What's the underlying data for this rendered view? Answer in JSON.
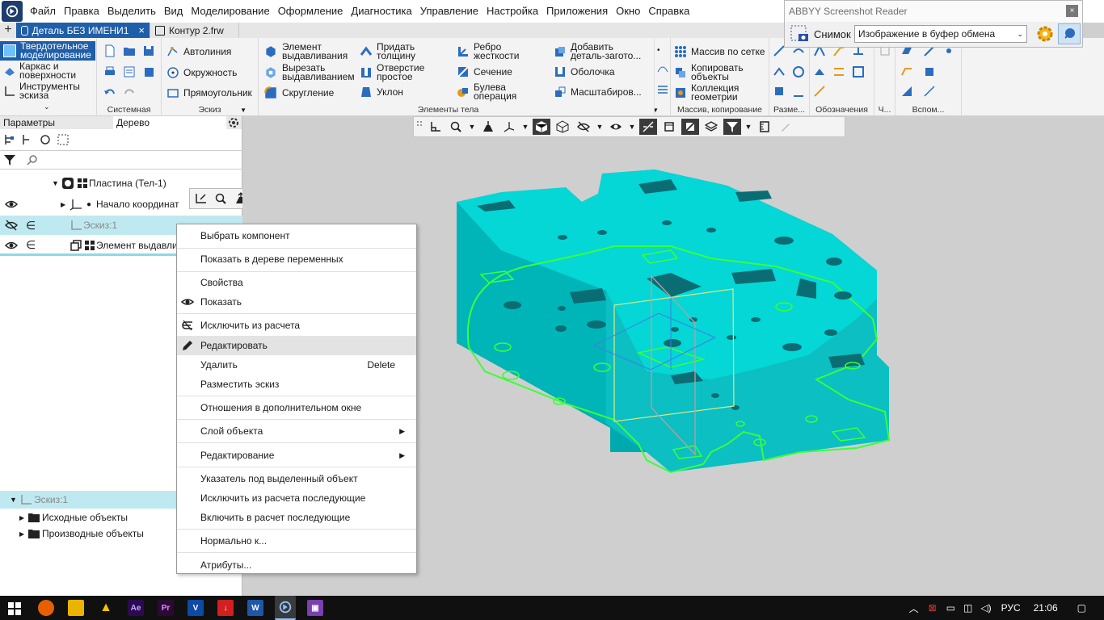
{
  "menubar": {
    "items": [
      "Файл",
      "Правка",
      "Выделить",
      "Вид",
      "Моделирование",
      "Оформление",
      "Диагностика",
      "Управление",
      "Настройка",
      "Приложения",
      "Окно",
      "Справка"
    ]
  },
  "tabs": [
    {
      "label": "Деталь БЕЗ ИМЕНИ1",
      "close": "×",
      "active": true
    },
    {
      "label": "Контур 2.frw",
      "close": "",
      "active": false
    }
  ],
  "ribbon": {
    "modes": [
      "Твердотельное моделирование",
      "Каркас и поверхности",
      "Инструменты эскиза"
    ],
    "sketch": {
      "autoline": "Автолиния",
      "circle": "Окружность",
      "rect": "Прямоугольник"
    },
    "body_elements": {
      "extrude": "Элемент выдавливания",
      "cut_extrude": "Вырезать выдавливанием",
      "fillet": "Скругление",
      "thicken": "Придать толщину",
      "hole": "Отверстие простое",
      "draft": "Уклон",
      "rib": "Ребро жесткости",
      "section": "Сечение",
      "boolean": "Булева операция",
      "add_blank": "Добавить деталь-загото...",
      "shell": "Оболочка",
      "scale": "Масштабиров..."
    },
    "array": {
      "grid": "Массив по сетке",
      "copy": "Копировать объекты",
      "collection": "Коллекция геометрии"
    },
    "groups": {
      "system": "Системная",
      "sketch": "Эскиз",
      "body": "Элементы тела",
      "array": "Массив, копирование",
      "dims": "Разме...",
      "annot": "Обозначения",
      "ch": "Ч...",
      "aux": "Вспом..."
    }
  },
  "panel": {
    "tabs": [
      "Параметры",
      "Дерево"
    ],
    "search_placeholder": "",
    "tree": [
      {
        "label": "Пластина (Тел-1)"
      },
      {
        "label": "Начало координат"
      },
      {
        "label": "Эскиз:1"
      },
      {
        "label": "Элемент выдавли"
      }
    ],
    "bottom_tree": [
      {
        "label": "Эскиз:1"
      },
      {
        "label": "Исходные объекты"
      },
      {
        "label": "Производные объекты"
      }
    ]
  },
  "context_menu": {
    "items": [
      {
        "label": "Выбрать компонент"
      },
      {
        "label": "Показать в дереве переменных"
      },
      {
        "label": "Свойства"
      },
      {
        "label": "Показать"
      },
      {
        "label": "Исключить из расчета"
      },
      {
        "label": "Редактировать"
      },
      {
        "label": "Удалить",
        "shortcut": "Delete"
      },
      {
        "label": "Разместить эскиз"
      },
      {
        "label": "Отношения в дополнительном окне"
      },
      {
        "label": "Слой объекта"
      },
      {
        "label": "Редактирование"
      },
      {
        "label": "Указатель под выделенный объект"
      },
      {
        "label": "Исключить из расчета последующие"
      },
      {
        "label": "Включить в расчет последующие"
      },
      {
        "label": "Нормально к..."
      },
      {
        "label": "Атрибуты..."
      }
    ]
  },
  "abbyy": {
    "title": "ABBYY Screenshot Reader",
    "close": "×",
    "snapshot_label": "Снимок",
    "mode_value": "Изображение в буфер обмена"
  },
  "taskbar": {
    "lang": "РУС",
    "time": "21:06"
  },
  "colors": {
    "accent": "#1f5ea8",
    "model": "#00c8c8",
    "highlight_edges": "#39ff39"
  }
}
